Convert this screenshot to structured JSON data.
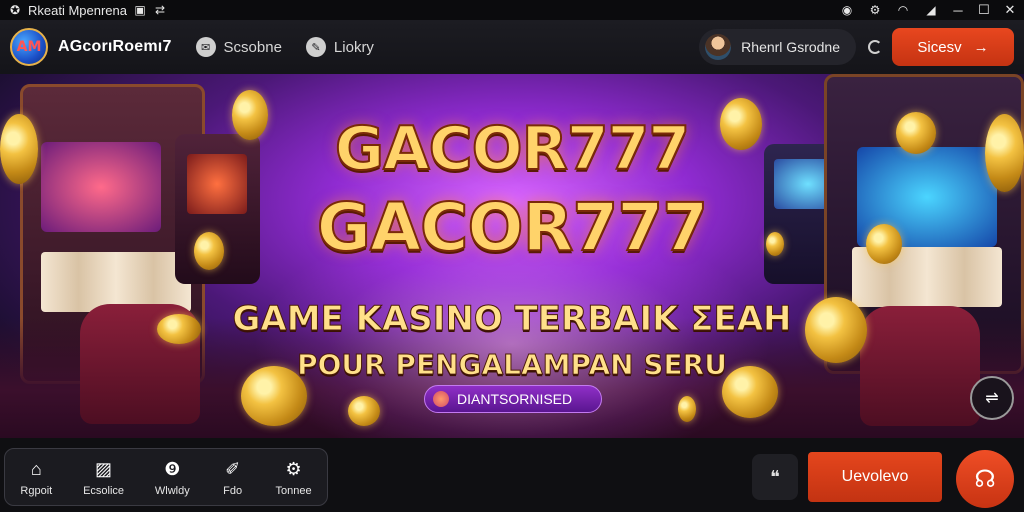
{
  "statusbar": {
    "title": "Rkeati Mpenrena",
    "left_icons": [
      "app-icon",
      "window-icon",
      "share-icon"
    ],
    "right_icons": [
      "record-icon",
      "settings-icon",
      "wifi-icon",
      "signal-icon"
    ]
  },
  "window_controls": [
    "minimize",
    "maximize",
    "close"
  ],
  "topnav": {
    "logo_text": "AM",
    "brand": "AGcorıRoemı7",
    "links": [
      {
        "label": "Scsobne",
        "icon": "chat-icon"
      },
      {
        "label": "Liokry",
        "icon": "pin-icon"
      }
    ],
    "user_name": "Rhenrl Gsrodne",
    "cta_label": "Sicesv"
  },
  "hero": {
    "headline_1": "GACOR777",
    "headline_2": "GACOR777",
    "tagline_1": "GAME KASINO TERBAIK ΣEAH",
    "tagline_2": "POUR PENGALAMPAN SERU",
    "promo_label": "DIANTSORNISED"
  },
  "bottombar": {
    "dock": [
      {
        "label": "Rgpoit",
        "icon": "home-icon"
      },
      {
        "label": "Ecsolice",
        "icon": "image-icon"
      },
      {
        "label": "Wlwldy",
        "icon": "info-icon"
      },
      {
        "label": "Fdo",
        "icon": "edit-icon"
      },
      {
        "label": "Tonnee",
        "icon": "gear-icon"
      }
    ],
    "cta_label": "Uevolevo"
  },
  "colors": {
    "accent": "#e5461d",
    "headline_gold": "#ffd36a",
    "hero_purple": "#8f2bd1"
  }
}
